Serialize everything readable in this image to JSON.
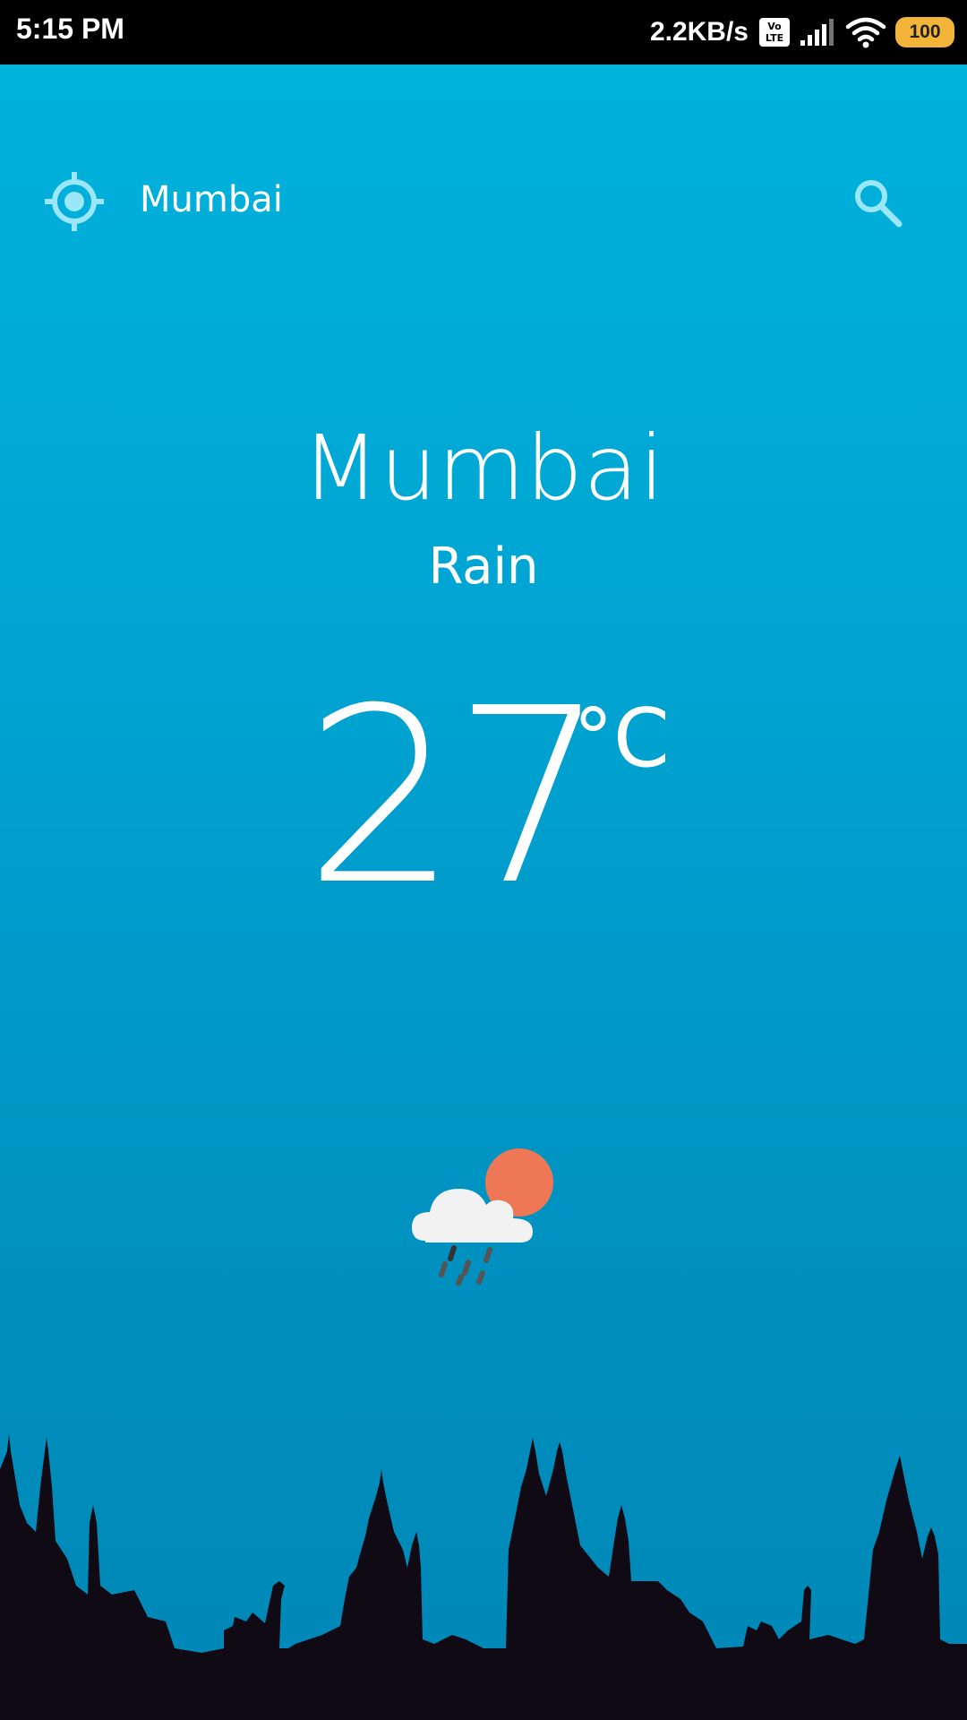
{
  "status_bar": {
    "time": "5:15 PM",
    "net_speed": "2.2KB/s",
    "volte_top": "Vo",
    "volte_bottom": "LTE",
    "battery": "100"
  },
  "toolbar": {
    "city": "Mumbai"
  },
  "weather": {
    "city": "Mumbai",
    "condition": "Rain",
    "temperature": "27",
    "unit": "°C"
  },
  "colors": {
    "background_top": "#00b3dd",
    "background_bottom": "#0087b6",
    "toolbar_icon": "#9be6f7",
    "sun": "#ee7755",
    "cloud": "#f2f2f2",
    "skyline": "#100a14"
  },
  "icons": {
    "location": "my-location-icon",
    "search": "search-icon",
    "weather": "cloud-sun-rain-icon"
  }
}
